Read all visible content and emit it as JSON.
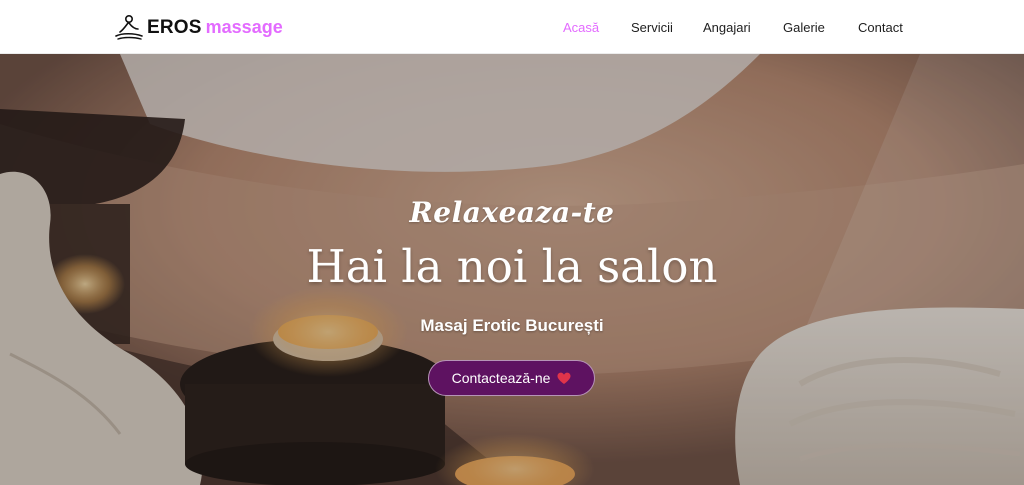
{
  "brand": {
    "name_part1": "EROS",
    "name_part2": "massage",
    "logo_icon": "massage-figure-icon",
    "accent_color": "#e36bff",
    "text_color": "#111111"
  },
  "nav": {
    "items": [
      {
        "label": "Acasă",
        "active": true
      },
      {
        "label": "Servicii",
        "active": false
      },
      {
        "label": "Angajari",
        "active": false
      },
      {
        "label": "Galerie",
        "active": false
      },
      {
        "label": "Contact",
        "active": false
      }
    ]
  },
  "hero": {
    "script_text": "Relaxeaza-te",
    "title": "Hai la noi la salon",
    "subtitle": "Masaj Erotic București",
    "cta_label": "Contactează-ne",
    "cta_icon": "heart-icon",
    "cta_color": "#5e1261",
    "heart_color": "#e0344a",
    "background_image": "spa-candles-towels-photo"
  }
}
